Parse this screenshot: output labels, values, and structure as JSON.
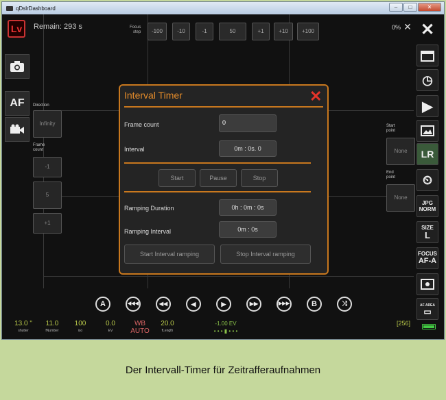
{
  "window": {
    "title": "qDslrDashboard"
  },
  "top": {
    "lv": "Lv",
    "remain": "Remain:  293 s",
    "focus_step_l1": "Focus",
    "focus_step_l2": "step",
    "focus_steps": [
      "-100",
      "-10",
      "-1",
      "50",
      "+1",
      "+10",
      "+100"
    ],
    "battery": "0%"
  },
  "left": {
    "direction_label": "Direction",
    "direction_value": "Infinity",
    "frame_count_l1": "Frame",
    "frame_count_l2": "count",
    "steps": [
      "-1",
      "5",
      "+1"
    ],
    "af": "AF"
  },
  "right_panel": {
    "start_l1": "Start",
    "start_l2": "point",
    "start_value": "None",
    "end_l1": "End",
    "end_l2": "point",
    "end_value": "None"
  },
  "right_bar": {
    "lr": "LR",
    "jpg": "JPG",
    "norm": "NORM",
    "size": "SIZE",
    "size_val": "L",
    "focus": "FOCUS",
    "focus_val": "AF-A",
    "af_area": "AF AREA"
  },
  "dialog": {
    "title": "Interval Timer",
    "frame_count_label": "Frame count",
    "frame_count_value": "0",
    "interval_label": "Interval",
    "interval_value": "0m : 0s. 0",
    "start": "Start",
    "pause": "Pause",
    "stop": "Stop",
    "ramping_duration_label": "Ramping Duration",
    "ramping_duration_value": "0h : 0m : 0s",
    "ramping_interval_label": "Ramping Interval",
    "ramping_interval_value": "0m : 0s",
    "start_ramping": "Start Interval ramping",
    "stop_ramping": "Stop Interval ramping"
  },
  "controls": {
    "a": "A",
    "b": "B"
  },
  "status": {
    "shutter": "13.0 \"",
    "shutter_l": "shutter",
    "fnumber": "11.0",
    "fnumber_l": "fNumber",
    "iso": "100",
    "iso_l": "iso",
    "ev": "0.0",
    "ev_l": "EV",
    "wb": "WB",
    "wb_val": "AUTO",
    "flength": "20.0",
    "flength_l": "fLength",
    "meter": "-1.00 EV",
    "count": "[256]"
  },
  "caption": "Der Intervall-Timer für Zeitrafferaufnahmen"
}
